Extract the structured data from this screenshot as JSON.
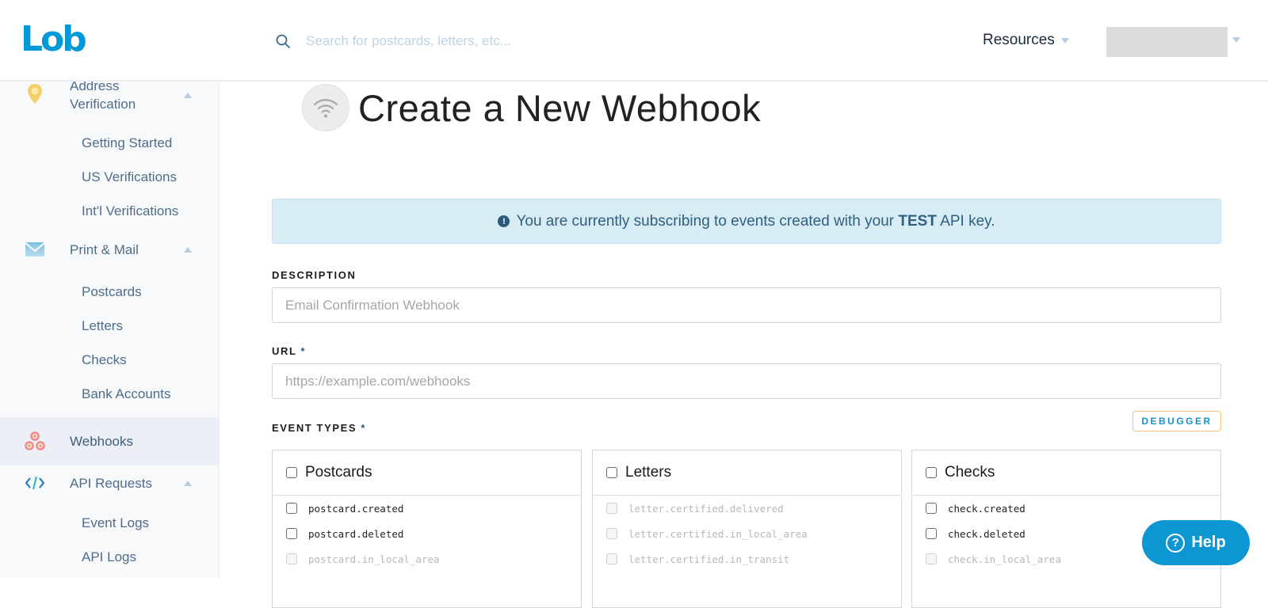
{
  "header": {
    "logo": "Lob",
    "search": {
      "placeholder": "Search for postcards, letters, etc..."
    },
    "resources_label": "Resources"
  },
  "sidebar": {
    "groups": [
      {
        "label": "Address Verification",
        "icon": "map-pin-icon",
        "expanded": true,
        "items": [
          "Getting Started",
          "US Verifications",
          "Int'l Verifications"
        ]
      },
      {
        "label": "Print & Mail",
        "icon": "envelope-icon",
        "expanded": true,
        "items": [
          "Postcards",
          "Letters",
          "Checks",
          "Bank Accounts"
        ]
      },
      {
        "label": "Webhooks",
        "icon": "webhook-icon",
        "active": true
      },
      {
        "label": "API Requests",
        "icon": "code-icon",
        "expanded": true,
        "items": [
          "Event Logs",
          "API Logs"
        ]
      }
    ]
  },
  "main": {
    "title": "Create a New Webhook",
    "title_icon": "wifi-icon",
    "alert": {
      "prefix": "You are currently subscribing to events created with your",
      "key": "TEST",
      "suffix": "API key."
    },
    "description": {
      "label": "DESCRIPTION",
      "placeholder": "Email Confirmation Webhook",
      "value": ""
    },
    "url": {
      "label": "URL",
      "required_mark": "*",
      "placeholder": "https://example.com/webhooks",
      "value": ""
    },
    "event_types": {
      "label": "EVENT TYPES",
      "required_mark": "*",
      "debugger_label": "DEBUGGER",
      "cards": [
        {
          "title": "Postcards",
          "events": [
            {
              "name": "postcard.created",
              "enabled": true
            },
            {
              "name": "postcard.deleted",
              "enabled": true
            },
            {
              "name": "postcard.in_local_area",
              "enabled": false
            }
          ]
        },
        {
          "title": "Letters",
          "events": [
            {
              "name": "letter.certified.delivered",
              "enabled": false
            },
            {
              "name": "letter.certified.in_local_area",
              "enabled": false
            },
            {
              "name": "letter.certified.in_transit",
              "enabled": false
            }
          ]
        },
        {
          "title": "Checks",
          "events": [
            {
              "name": "check.created",
              "enabled": true
            },
            {
              "name": "check.deleted",
              "enabled": true
            },
            {
              "name": "check.in_local_area",
              "enabled": false
            }
          ]
        }
      ]
    }
  },
  "help_button": {
    "label": "Help"
  },
  "colors": {
    "brand": "#0099d7",
    "alert_bg": "#d8ecf6",
    "debugger_border": "#f4c27e",
    "active_nav": "#ecf0f6"
  }
}
